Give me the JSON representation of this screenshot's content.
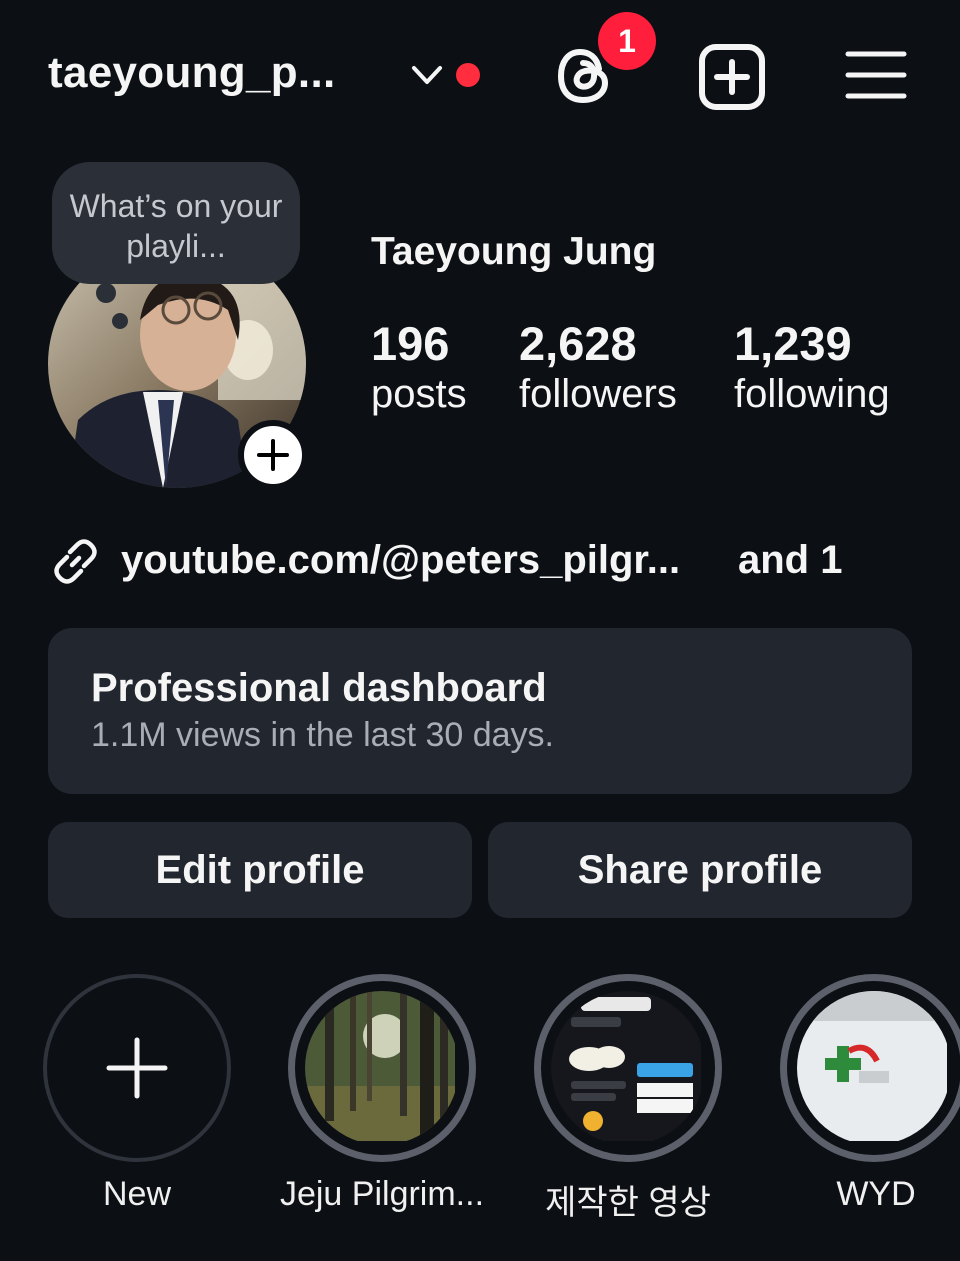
{
  "header": {
    "username": "taeyoung_p...",
    "notification_count": "1",
    "icons": [
      "chevron-down-icon",
      "threads-icon",
      "new-post-icon",
      "menu-icon"
    ],
    "notification_dot_color": "#ff2d3d"
  },
  "profile": {
    "note_text": "What’s on your playli...",
    "full_name": "Taeyoung Jung",
    "stats": [
      {
        "value": "196",
        "label": "posts"
      },
      {
        "value": "2,628",
        "label": "followers"
      },
      {
        "value": "1,239",
        "label": "following"
      }
    ],
    "link_text": "youtube.com/@peters_pilgr...",
    "link_more": "and 1"
  },
  "dashboard": {
    "title": "Professional dashboard",
    "subtitle": "1.1M views in the last 30 days."
  },
  "actions": {
    "edit_label": "Edit profile",
    "share_label": "Share profile"
  },
  "highlights": [
    {
      "label": "New"
    },
    {
      "label": "Jeju Pilgrim..."
    },
    {
      "label": "제작한 영상"
    },
    {
      "label": "WYD"
    }
  ]
}
